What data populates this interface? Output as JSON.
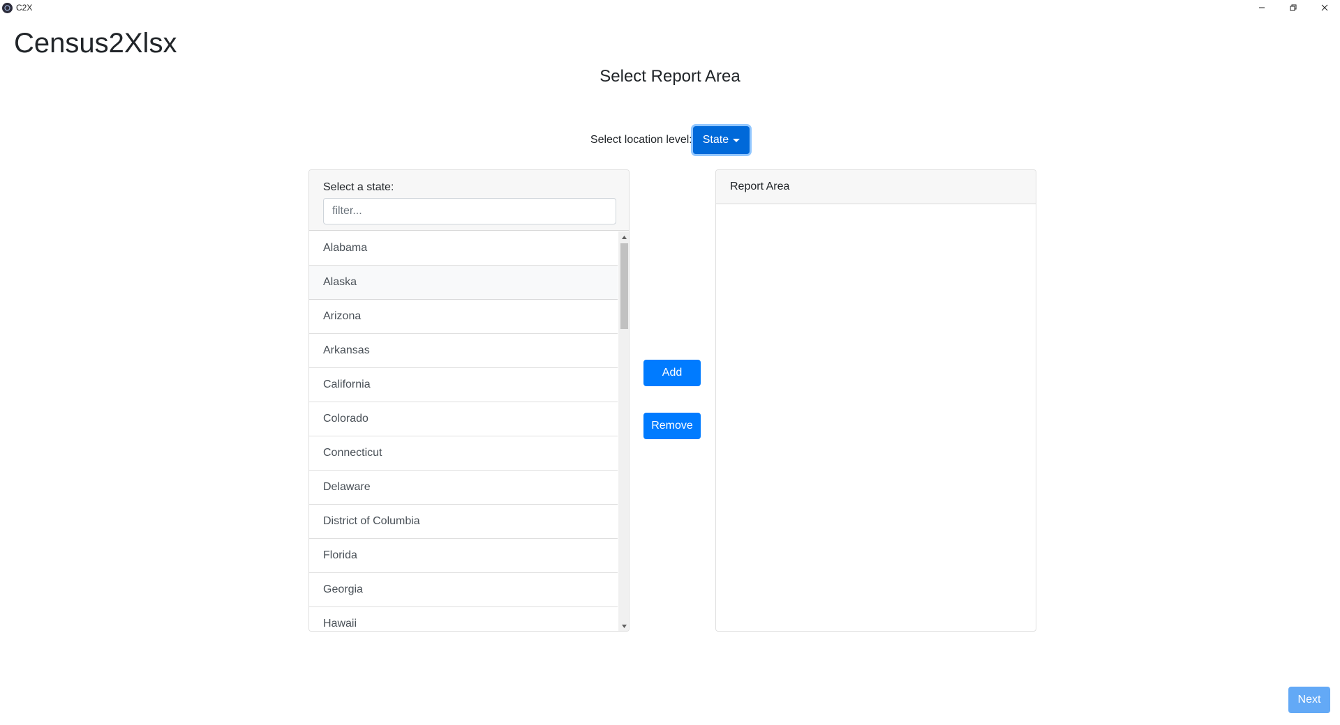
{
  "window": {
    "title": "C2X",
    "icon": "c2x-app-icon",
    "controls": [
      "minimize-icon",
      "restore-icon",
      "close-icon"
    ]
  },
  "header": {
    "app_name": "Census2Xlsx",
    "page_heading": "Select Report Area"
  },
  "location_level": {
    "label": "Select location level:",
    "selected": "State"
  },
  "state_panel": {
    "label": "Select a state:",
    "filter_placeholder": "filter...",
    "filter_value": "",
    "states": [
      "Alabama",
      "Alaska",
      "Arizona",
      "Arkansas",
      "California",
      "Colorado",
      "Connecticut",
      "Delaware",
      "District of Columbia",
      "Florida",
      "Georgia",
      "Hawaii"
    ],
    "hovered_index": 1
  },
  "actions": {
    "add_label": "Add",
    "remove_label": "Remove"
  },
  "report_area": {
    "header": "Report Area",
    "items": []
  },
  "footer": {
    "next_label": "Next"
  },
  "colors": {
    "primary": "#007bff",
    "primary_active": "#0069d9",
    "next_disabled": "#63a9f6",
    "card_header_bg": "#f7f7f7"
  }
}
